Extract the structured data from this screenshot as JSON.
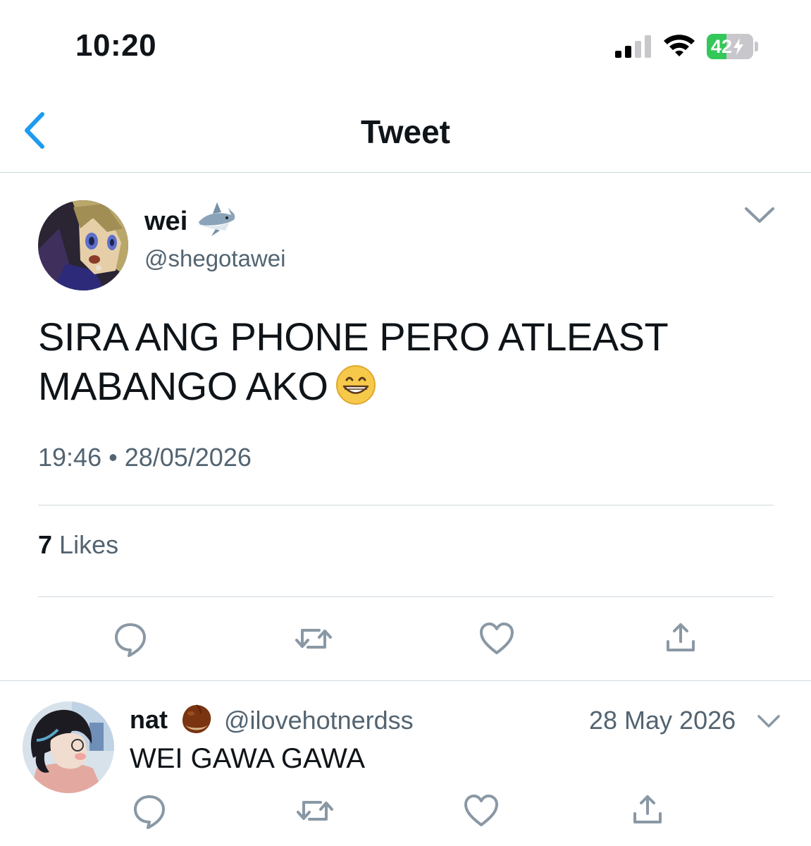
{
  "status_bar": {
    "time": "10:20",
    "battery_percent": "42",
    "battery_level": 0.42,
    "signal_bars_active": 2,
    "signal_bars_total": 4,
    "charging": true
  },
  "nav": {
    "title": "Tweet",
    "back_icon": "chevron-left-icon"
  },
  "tweet": {
    "author_name": "wei",
    "author_emoji": "shark",
    "handle": "@shegotawei",
    "text_line1": "SIRA ANG PHONE PERO ATLEAST",
    "text_line2": "MABANGO AKO",
    "text_emoji": "grinning-face",
    "meta": "19:46 • 28/05/2026",
    "likes_count": "7",
    "likes_label": "Likes"
  },
  "actions": [
    "reply-icon",
    "retweet-icon",
    "like-icon",
    "share-icon"
  ],
  "reply": {
    "author_name": "nat",
    "author_emoji": "chestnut",
    "handle": "@ilovehotnerdss",
    "date": "28 May 2026",
    "text": "WEI GAWA GAWA"
  },
  "colors": {
    "accent": "#1d9bf0",
    "text": "#0f1419",
    "secondary": "#536471",
    "icon": "#8a98a5",
    "divider": "#cfd9de",
    "battery_green": "#34c759"
  }
}
